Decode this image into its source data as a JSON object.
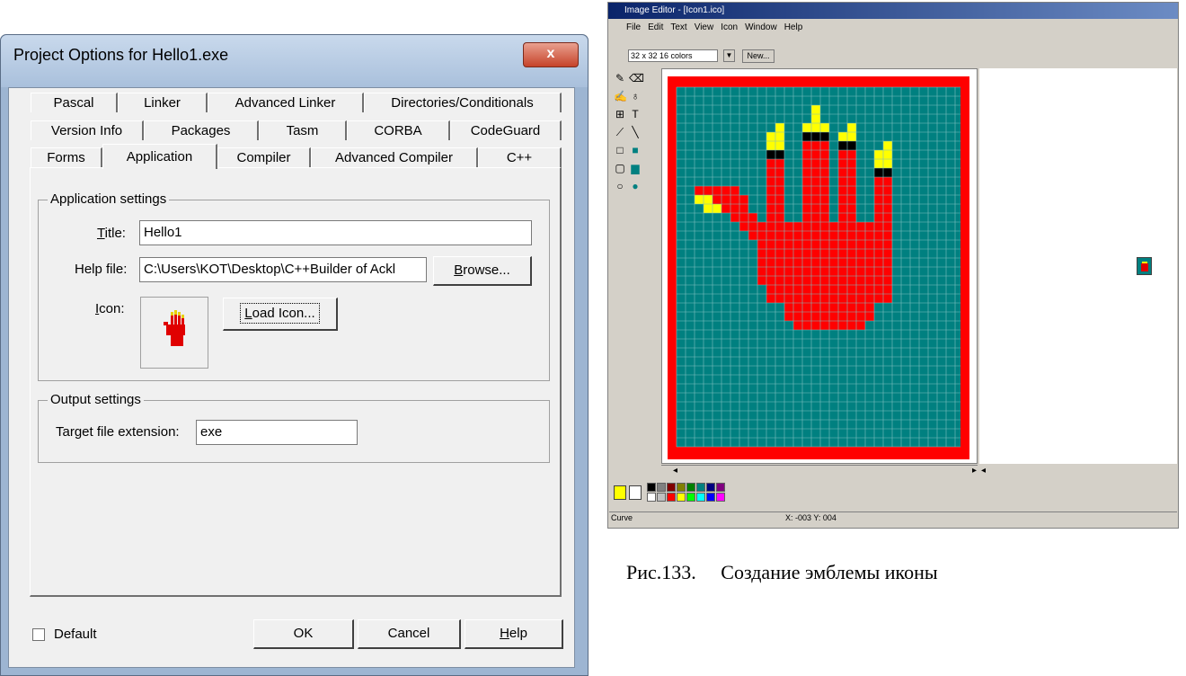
{
  "dialog": {
    "title": "Project Options for Hello1.exe",
    "close_label": "x",
    "tabs_row1": [
      "Pascal",
      "Linker",
      "Advanced Linker",
      "Directories/Conditionals"
    ],
    "tabs_row2": [
      "Version Info",
      "Packages",
      "Tasm",
      "CORBA",
      "CodeGuard"
    ],
    "tabs_row3": [
      "Forms",
      "Application",
      "Compiler",
      "Advanced Compiler",
      "C++"
    ],
    "active_tab": "Application",
    "app_group_label": "Application settings",
    "title_label_u": "T",
    "title_label_rest": "itle:",
    "title_value": "Hello1",
    "help_label": "Help file:",
    "help_value": "C:\\Users\\KOT\\Desktop\\C++Builder of Ackl",
    "browse_u": "B",
    "browse_rest": "rowse...",
    "icon_label_u": "I",
    "icon_label_rest": "con:",
    "load_u": "L",
    "load_rest": "oad Icon...",
    "output_group_label": "Output settings",
    "ext_label": "Target file extension:",
    "ext_value": "exe",
    "default_label": "Default",
    "ok_label": "OK",
    "cancel_label": "Cancel",
    "help_u": "H",
    "help_rest": "elp"
  },
  "image_editor": {
    "title": "Image Editor - [Icon1.ico]",
    "menu": [
      "File",
      "Edit",
      "Text",
      "View",
      "Icon",
      "Window",
      "Help"
    ],
    "size_select": "32 x 32 16 colors",
    "new_button": "New...",
    "status_tool": "Curve",
    "status_coords": "X: -003 Y: 004",
    "foreground_color": "#ffff00",
    "background_color": "#ffffff",
    "palette_row1": [
      "#000000",
      "#808080",
      "#800000",
      "#808000",
      "#008000",
      "#008080",
      "#000080",
      "#800080"
    ],
    "palette_row2": [
      "#ffffff",
      "#c0c0c0",
      "#ff0000",
      "#ffff00",
      "#00ff00",
      "#00ffff",
      "#0000ff",
      "#ff00ff"
    ],
    "canvas_bg": "#008080",
    "canvas_frame": "#ff0000"
  },
  "caption": "Рис.133.     Создание эмблемы иконы"
}
